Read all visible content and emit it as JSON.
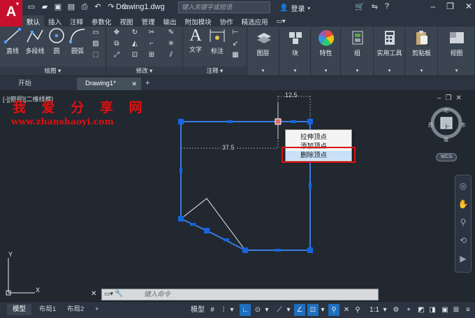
{
  "app": {
    "logo_letter": "A",
    "doc_title": "Drawing1.dwg",
    "search_placeholder": "键入关键字或短语",
    "login_label": "登录"
  },
  "menu_tabs": [
    "默认",
    "插入",
    "注释",
    "参数化",
    "视图",
    "管理",
    "输出",
    "附加模块",
    "协作",
    "精选应用"
  ],
  "ribbon": {
    "draw_tools": [
      "直线",
      "多段线",
      "圆",
      "圆弧"
    ],
    "draw_panel": "绘图",
    "modify_panel": "修改",
    "annotation_tools": [
      "文字",
      "标注"
    ],
    "annotation_panel": "注释",
    "big_buttons": [
      "图层",
      "块",
      "特性",
      "组",
      "实用工具",
      "剪贴板",
      "视图"
    ]
  },
  "file_tabs": {
    "start": "开始",
    "drawing": "Drawing1*"
  },
  "viewport": {
    "label": "[-][俯视][二维线框]",
    "watermark_title": "我 爱 分 享 网",
    "watermark_url": "www.zhanshaoyi.com",
    "dim_top": "12.5",
    "dim_left": "37.5",
    "viewcube": {
      "top_face": "上",
      "north": "北",
      "south": "南",
      "east": "东",
      "west": "西"
    },
    "wcs_label": "WCS"
  },
  "context_menu": {
    "items": [
      "拉伸顶点",
      "添加顶点",
      "删除顶点"
    ],
    "highlighted_index": 2
  },
  "command_line": {
    "placeholder": "键入命令"
  },
  "status": {
    "tabs": [
      "模型",
      "布局1",
      "布局2"
    ],
    "model_label": "模型",
    "scale": "1:1"
  },
  "colors": {
    "accent_red": "#e01010",
    "grip_blue": "#1565e0",
    "polyline": "#3b7ae0"
  }
}
